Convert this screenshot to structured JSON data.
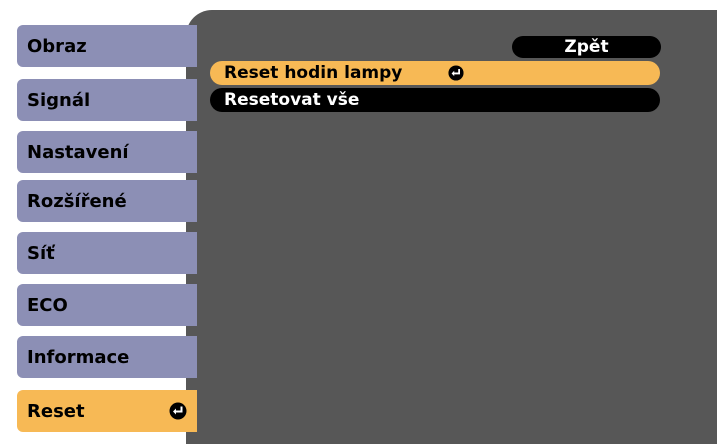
{
  "sidebar": {
    "items": [
      {
        "label": "Obraz"
      },
      {
        "label": "Signál"
      },
      {
        "label": "Nastavení"
      },
      {
        "label": "Rozšířené"
      },
      {
        "label": "Síť"
      },
      {
        "label": "ECO"
      },
      {
        "label": "Informace"
      },
      {
        "label": "Reset",
        "selected": true,
        "icon": "enter-icon"
      }
    ]
  },
  "main": {
    "back_label": "Zpět",
    "items": [
      {
        "label": "Reset hodin lampy",
        "selected": true,
        "icon": "enter-icon"
      },
      {
        "label": "Resetovat vše"
      }
    ]
  },
  "colors": {
    "tab": "#8c8fb5",
    "highlight": "#f7b955",
    "panel": "#575757",
    "item": "#000000"
  }
}
